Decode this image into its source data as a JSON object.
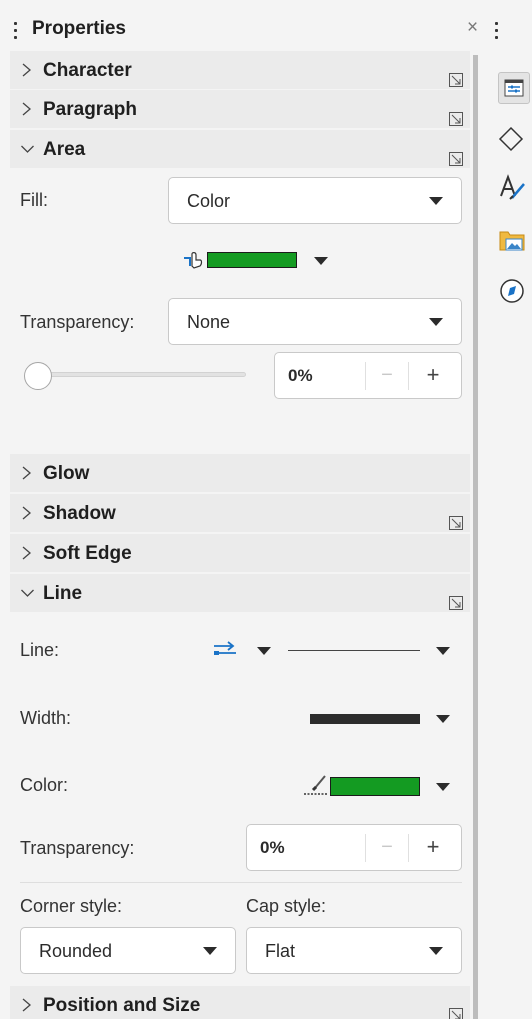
{
  "panel": {
    "title": "Properties"
  },
  "sections": {
    "character": "Character",
    "paragraph": "Paragraph",
    "area": "Area",
    "glow": "Glow",
    "shadow": "Shadow",
    "soft_edge": "Soft Edge",
    "line": "Line",
    "position_size": "Position and Size"
  },
  "area": {
    "fill_label": "Fill:",
    "fill_value": "Color",
    "fill_color": "#149b22",
    "transparency_label": "Transparency:",
    "transparency_mode": "None",
    "transparency_value": "0%",
    "transparency_slider": 0
  },
  "line": {
    "line_label": "Line:",
    "width_label": "Width:",
    "color_label": "Color:",
    "line_color": "#149b22",
    "transparency_label": "Transparency:",
    "transparency_value": "0%",
    "corner_label": "Corner style:",
    "corner_value": "Rounded",
    "cap_label": "Cap style:",
    "cap_value": "Flat"
  },
  "deck": {
    "tabs": [
      "properties-icon",
      "shapes-icon",
      "styles-icon",
      "gallery-icon",
      "navigator-icon"
    ],
    "accent": "#1a73c7"
  }
}
